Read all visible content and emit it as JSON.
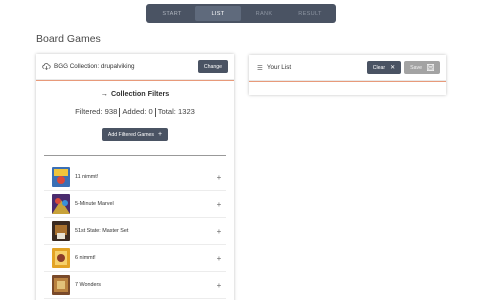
{
  "nav": {
    "steps": [
      "START",
      "LIST",
      "RANK",
      "RESULT"
    ],
    "active_step": "LIST"
  },
  "page": {
    "title": "Board Games"
  },
  "collection": {
    "header_label": "BGG Collection: drupalviking",
    "change_label": "Change",
    "filters_title": "Collection Filters",
    "filtered": "Filtered: 938",
    "added": "Added: 0",
    "total": "Total: 1323",
    "add_filtered_label": "Add Filtered Games",
    "games": [
      {
        "name": "11 nimmt!",
        "icon": "board-game-thumbnail"
      },
      {
        "name": "5-Minute Marvel",
        "icon": "board-game-thumbnail"
      },
      {
        "name": "51st State: Master Set",
        "icon": "board-game-thumbnail"
      },
      {
        "name": "6 nimmt!",
        "icon": "board-game-thumbnail"
      },
      {
        "name": "7 Wonders",
        "icon": "board-game-thumbnail"
      }
    ]
  },
  "your_list": {
    "title": "Your List",
    "clear_label": "Clear",
    "save_label": "Save"
  },
  "colors": {
    "nav_bg": "#4a5363",
    "button_dark": "#4a5363",
    "button_disabled": "#a3a3a3",
    "accent_line": "#e89a7a"
  }
}
